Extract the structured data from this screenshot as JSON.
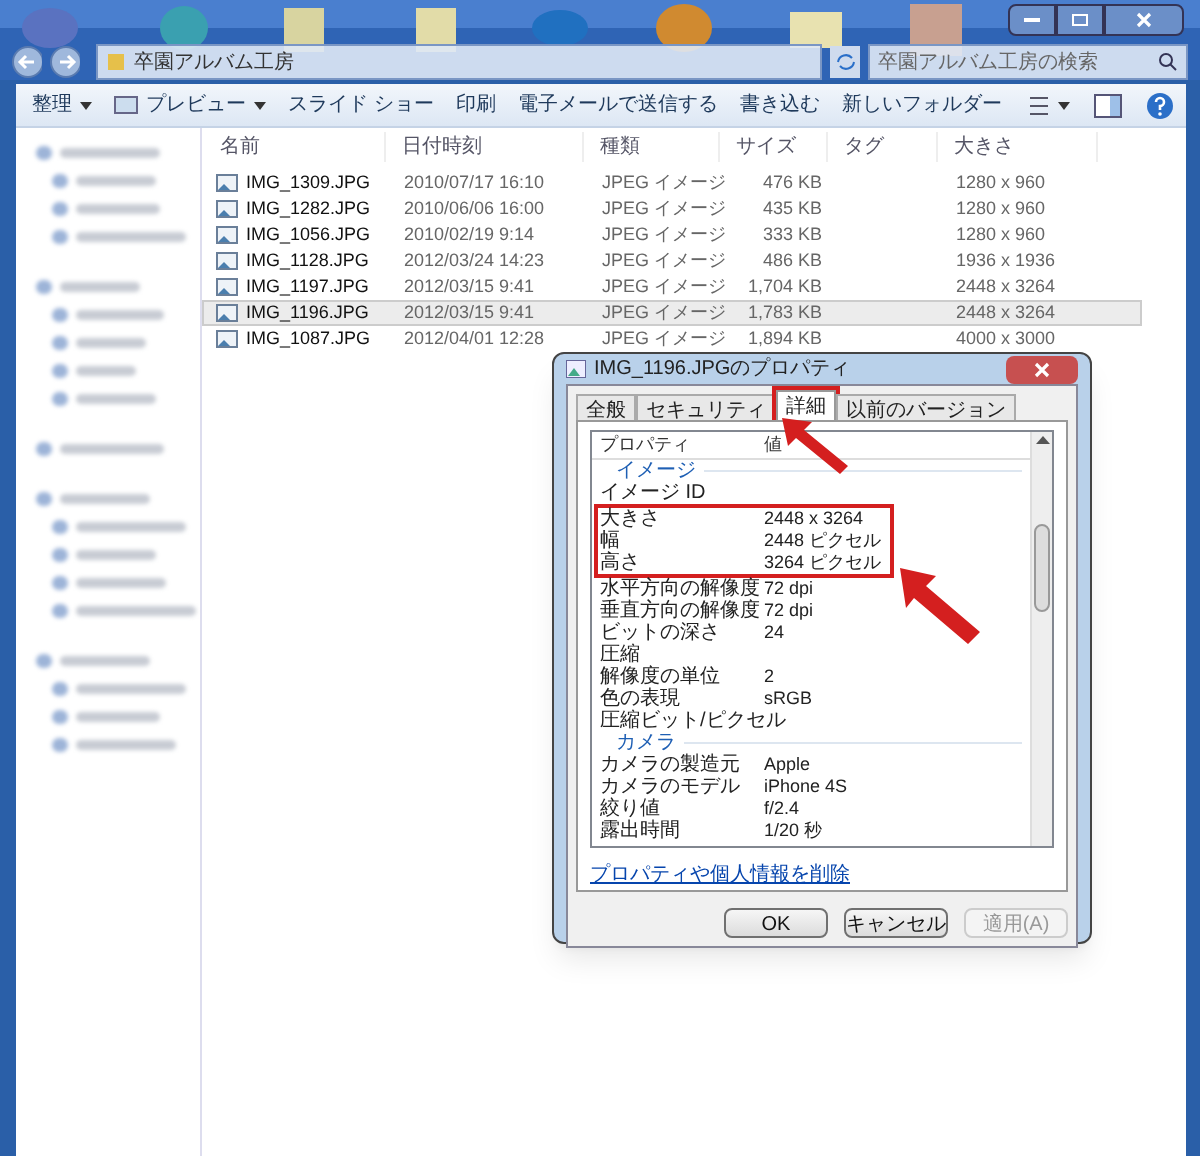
{
  "explorer": {
    "address": "卒園アルバム工房",
    "search": {
      "placeholder": "卒園アルバム工房の検索"
    },
    "toolbar": [
      {
        "label": "整理",
        "kind": "menu"
      },
      {
        "label": "プレビュー",
        "kind": "preview"
      },
      {
        "label": "スライド ショー",
        "kind": "plain"
      },
      {
        "label": "印刷",
        "kind": "plain"
      },
      {
        "label": "電子メールで送信する",
        "kind": "plain"
      },
      {
        "label": "書き込む",
        "kind": "plain"
      },
      {
        "label": "新しいフォルダー",
        "kind": "plain"
      }
    ],
    "columns": [
      "名前",
      "日付時刻",
      "種類",
      "サイズ",
      "タグ",
      "大きさ"
    ],
    "rows": [
      {
        "name": "IMG_1309.JPG",
        "date": "2010/07/17 16:10",
        "type": "JPEG イメージ",
        "size": "476 KB",
        "dimensions": "1280 x 960",
        "selected": false
      },
      {
        "name": "IMG_1282.JPG",
        "date": "2010/06/06 16:00",
        "type": "JPEG イメージ",
        "size": "435 KB",
        "dimensions": "1280 x 960",
        "selected": false
      },
      {
        "name": "IMG_1056.JPG",
        "date": "2010/02/19 9:14",
        "type": "JPEG イメージ",
        "size": "333 KB",
        "dimensions": "1280 x 960",
        "selected": false
      },
      {
        "name": "IMG_1128.JPG",
        "date": "2012/03/24 14:23",
        "type": "JPEG イメージ",
        "size": "486 KB",
        "dimensions": "1936 x 1936",
        "selected": false
      },
      {
        "name": "IMG_1197.JPG",
        "date": "2012/03/15 9:41",
        "type": "JPEG イメージ",
        "size": "1,704 KB",
        "dimensions": "2448 x 3264",
        "selected": false
      },
      {
        "name": "IMG_1196.JPG",
        "date": "2012/03/15 9:41",
        "type": "JPEG イメージ",
        "size": "1,783 KB",
        "dimensions": "2448 x 3264",
        "selected": true
      },
      {
        "name": "IMG_1087.JPG",
        "date": "2012/04/01 12:28",
        "type": "JPEG イメージ",
        "size": "1,894 KB",
        "dimensions": "4000 x 3000",
        "selected": false
      }
    ]
  },
  "dialog": {
    "title": "IMG_1196.JPGのプロパティ",
    "tabs": [
      {
        "label": "全般",
        "selected": false,
        "highlighted": false
      },
      {
        "label": "セキュリティ",
        "selected": false,
        "highlighted": false
      },
      {
        "label": "詳細",
        "selected": true,
        "highlighted": true
      },
      {
        "label": "以前のバージョン",
        "selected": false,
        "highlighted": false
      }
    ],
    "columns": [
      "プロパティ",
      "値"
    ],
    "items": [
      {
        "kind": "section",
        "label": "イメージ"
      },
      {
        "kind": "prop",
        "label": "イメージ ID",
        "value": "",
        "highlighted": false
      },
      {
        "kind": "prop",
        "label": "大きさ",
        "value": "2448 x 3264",
        "highlighted": true
      },
      {
        "kind": "prop",
        "label": "幅",
        "value": "2448 ピクセル",
        "highlighted": true
      },
      {
        "kind": "prop",
        "label": "高さ",
        "value": "3264 ピクセル",
        "highlighted": true
      },
      {
        "kind": "prop",
        "label": "水平方向の解像度",
        "value": "72 dpi",
        "highlighted": false
      },
      {
        "kind": "prop",
        "label": "垂直方向の解像度",
        "value": "72 dpi",
        "highlighted": false
      },
      {
        "kind": "prop",
        "label": "ビットの深さ",
        "value": "24",
        "highlighted": false
      },
      {
        "kind": "prop",
        "label": "圧縮",
        "value": "",
        "highlighted": false
      },
      {
        "kind": "prop",
        "label": "解像度の単位",
        "value": "2",
        "highlighted": false
      },
      {
        "kind": "prop",
        "label": "色の表現",
        "value": "sRGB",
        "highlighted": false
      },
      {
        "kind": "prop",
        "label": "圧縮ビット/ピクセル",
        "value": "",
        "highlighted": false
      },
      {
        "kind": "section",
        "label": "カメラ"
      },
      {
        "kind": "prop",
        "label": "カメラの製造元",
        "value": "Apple",
        "highlighted": false
      },
      {
        "kind": "prop",
        "label": "カメラのモデル",
        "value": "iPhone 4S",
        "highlighted": false
      },
      {
        "kind": "prop",
        "label": "絞り値",
        "value": "f/2.4",
        "highlighted": false
      },
      {
        "kind": "prop",
        "label": "露出時間",
        "value": "1/20 秒",
        "highlighted": false
      }
    ],
    "link": "プロパティや個人情報を削除",
    "buttons": [
      {
        "label": "OK",
        "disabled": false
      },
      {
        "label": "キャンセル",
        "disabled": false
      },
      {
        "label": "適用(A)",
        "disabled": true
      }
    ]
  }
}
